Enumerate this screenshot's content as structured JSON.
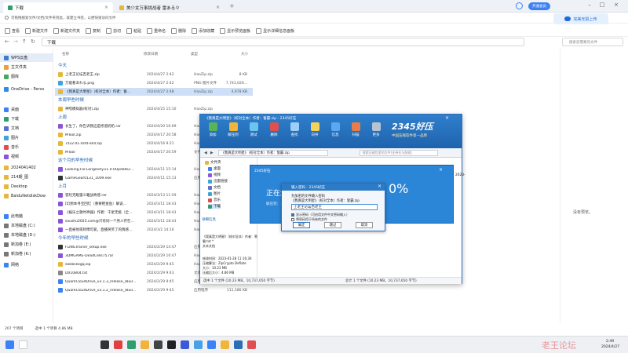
{
  "tabs": [
    {
      "label": "下载"
    },
    {
      "label": "美少女万事挑战者 雷ある々"
    }
  ],
  "vip": "开通会员",
  "notice": "可拖拽搜索文件/文档/文件夹到此，就建立书签，以便快速访问文件",
  "upload": "完美无损上传",
  "toolbar": [
    {
      "label": "查看",
      "icon": "eye-icon"
    },
    {
      "label": "新建文件",
      "icon": "new-file-icon"
    },
    {
      "label": "新建文件夹",
      "icon": "new-folder-icon"
    },
    {
      "label": "复制",
      "icon": "copy-icon"
    },
    {
      "label": "剪切",
      "icon": "cut-icon"
    },
    {
      "label": "粘贴",
      "icon": "paste-icon"
    },
    {
      "label": "重命名",
      "icon": "rename-icon"
    },
    {
      "label": "删除",
      "icon": "delete-icon"
    },
    {
      "label": "添加收藏",
      "icon": "star-icon"
    },
    {
      "label": "显示预览面板",
      "icon": "preview-icon"
    },
    {
      "label": "显示详细信息面板",
      "icon": "details-icon"
    }
  ],
  "address": "下载",
  "search_placeholder": "搜索您需要的文件",
  "sidebar": [
    {
      "label": "WPS云盘",
      "color": "#3a7bd5",
      "sel": true
    },
    {
      "label": "主文件夹",
      "color": "#e6a23c"
    },
    {
      "label": "图库",
      "color": "#48a860"
    },
    {
      "label": "OneDrive - Perso",
      "color": "#2d8ce6"
    },
    {
      "label": "桌面",
      "color": "#3b82f6"
    },
    {
      "label": "下载",
      "color": "#2f9e6a"
    },
    {
      "label": "文档",
      "color": "#5a6fd6"
    },
    {
      "label": "图片",
      "color": "#3aa5d6"
    },
    {
      "label": "音乐",
      "color": "#e24c4c"
    },
    {
      "label": "视频",
      "color": "#8a56d8"
    },
    {
      "label": "2024041402",
      "color": "#e6b73c"
    },
    {
      "label": "214期_图",
      "color": "#e6b73c"
    },
    {
      "label": "Desktop",
      "color": "#e6b73c"
    },
    {
      "label": "BaiduNetdiskDow",
      "color": "#e6b73c"
    },
    {
      "label": "此电脑",
      "color": "#3b82f6"
    },
    {
      "label": "本地磁盘 (C:)",
      "color": "#777"
    },
    {
      "label": "本地磁盘 (D:)",
      "color": "#777"
    },
    {
      "label": "新加卷 (E:)",
      "color": "#777"
    },
    {
      "label": "新加卷 (K:)",
      "color": "#777"
    },
    {
      "label": "网络",
      "color": "#3b82f6"
    }
  ],
  "columns": {
    "name": "名称",
    "date": "修改日期",
    "type": "类型",
    "size": "大小"
  },
  "groups": [
    {
      "label": "今天",
      "rows": [
        {
          "name": "上老王论坛百老王.zip",
          "date": "2024/4/27 2:42",
          "type": "HaoZip.zip",
          "size": "8 KB",
          "color": "#e6b73c"
        },
        {
          "name": "万能看あれる.png",
          "date": "2024/4/27 2:42",
          "type": "PNG 图片文件",
          "size": "7,741,020...",
          "color": "#3aa5d6"
        },
        {
          "name": "《我真是大明星》（校对全本）作者：誓...",
          "date": "2024/4/27 2:48",
          "type": "HaoZip.zip",
          "size": "4,978 KB",
          "color": "#e6b73c",
          "sel": true
        }
      ]
    },
    {
      "label": "本周早些时候",
      "rows": [
        {
          "name": "神嗒模拟器(校对).zip",
          "date": "2024/4/25 15:10",
          "type": "HaoZip.zip",
          "size": "",
          "color": "#e6b73c"
        }
      ]
    },
    {
      "label": "上周",
      "rows": [
        {
          "name": "长生了，你告诉我这是修道奶奶.rar",
          "date": "2024/4/20 16:09",
          "type": "HaoZip.rar",
          "size": "",
          "color": "#8a56d8"
        },
        {
          "name": "MTool.zip",
          "date": "2024/4/17 20:58",
          "type": "HaoZip.zip",
          "size": "",
          "color": "#e6b73c"
        },
        {
          "name": "7z22.01-zstd-x64.zip",
          "date": "2024/4/16 9:21",
          "type": "HaoZip.zip",
          "size": "",
          "color": "#e6b73c"
        },
        {
          "name": "MTool",
          "date": "2024/4/17 20:59",
          "type": "文件夹",
          "size": "",
          "color": "#e6b73c"
        }
      ]
    },
    {
      "label": "这个月的早些时候",
      "rows": [
        {
          "name": "Looking.For.Longevity.v1.0.0Update2...",
          "date": "2024/4/11 15:14",
          "type": "HaoZip.rar",
          "size": "",
          "color": "#8a56d8"
        },
        {
          "name": "GameGear0131_1009.exe",
          "date": "2024/4/11 15:13",
          "type": "应用程序",
          "size": "",
          "color": "#333"
        }
      ]
    },
    {
      "label": "上月",
      "rows": [
        {
          "name": "冒险无眠骚义籍战奇悠.rar",
          "date": "2024/3/13 11:59",
          "type": "HaoZip.rar",
          "size": "",
          "color": "#8a56d8"
        },
        {
          "name": "[幻想本寻宝回忆（重要鞋金鱼）解说...",
          "date": "2024/3/11 18:43",
          "type": "HaoZip.rar",
          "size": "",
          "color": "#8a56d8"
        },
        {
          "name": "《娱乐之歌时神器》作者：千星无极（全...",
          "date": "2024/3/11 18:43",
          "type": "HaoZip.rar",
          "size": "",
          "color": "#8a56d8"
        },
        {
          "name": "soushu2023.com@只有同一个男人存在...",
          "date": "2024/3/11 18:43",
          "type": "HaoZip.rar",
          "size": "",
          "color": "#8a56d8"
        },
        {
          "name": "一直被他或师傅可爱，直播哭笑了的情感...",
          "date": "2024/3/2 14:16",
          "type": "HaoZip.rar",
          "size": "",
          "color": "#8a56d8"
        }
      ]
    },
    {
      "label": "今年的早些时候",
      "rows": [
        {
          "name": "FLiNGTrainer_setup.exe",
          "date": "2024/2/29 14:47",
          "type": "应用程序",
          "size": "",
          "color": "#333"
        },
        {
          "name": "3DMGAME-DeadCells75.rar",
          "date": "2024/2/29 10:47",
          "type": "HaoZip.rar",
          "size": "",
          "color": "#8a56d8"
        },
        {
          "name": "swsbsexgq.zip",
          "date": "2024/2/29 9:45",
          "type": "HaoZip.zip",
          "size": "",
          "color": "#e6b73c"
        },
        {
          "name": "D010804.txt",
          "date": "2024/2/29 9:43",
          "type": "文本文档",
          "size": "",
          "color": "#888"
        },
        {
          "name": "QuarkCloudDrive_v3.1.3_release_(Buil...",
          "date": "2024/2/29 9:45",
          "type": "应用程序",
          "size": "111,186 KB",
          "color": "#3b82f6"
        },
        {
          "name": "QuarkCloudDrive_v3.1.2_release_(Buil...",
          "date": "2024/2/29 9:45",
          "type": "应用程序",
          "size": "111,186 KB",
          "color": "#3b82f6"
        }
      ]
    }
  ],
  "preview_text": "没有预览。",
  "status": {
    "count": "207 个项目",
    "selected": "选中 1 个项目  4.86 MB"
  },
  "zip": {
    "brand": "2345好压",
    "slogan": "中国压缩软件第一品牌",
    "title": "《我真是大明星》（校对全本）作者：誓霸.zip - 2345好压",
    "buttons": [
      "添加",
      "解压到",
      "测试",
      "删除",
      "查找",
      "向导",
      "信息",
      "扫描",
      "更多"
    ],
    "path": "《我真是大明星》（校对全本）作者：誓霸.zip",
    "search_placeholder": "搜索压缩包里的文件(支持名与前缀)",
    "tree": [
      "文件夹",
      "桌面",
      "视频",
      "迅雷链接",
      "文档",
      "图片",
      "音乐",
      "下载"
    ],
    "info_label": "详细信息",
    "info": [
      "《我真是大明星》（校对全本）作者：誓霸.txt *",
      "文本文档",
      "修改时间：2023-01-28 11:16:30",
      "压缩算法：ZipCrypto Deflate",
      "大小：10.23 MB",
      "压缩后大小：4.86 MB"
    ],
    "col": "安全",
    "year": "2023-",
    "status": "选中 1 个文件 (10.23 MB，10,737,650 字节)",
    "status2": "总计 1 个文件 (10.23 MB，10,737,650 字节)"
  },
  "progress": {
    "title": "2345好压",
    "text": "正在解",
    "sub": "解压到：..."
  },
  "pwd": {
    "title": "输入密码 - 2345好压",
    "prompt": "为加密的文件输入密码",
    "file": "《我真是大明星》（校对全本）作者：誓霸.zip",
    "value": "上老王论坛百老王",
    "show": "显示密码（可启用文件中文密码输入）",
    "save": "将密码用于所有的文件",
    "ok": "确定",
    "skip": "跳过",
    "cancel": "取消"
  },
  "clock": {
    "time": "2:49",
    "date": "2024/4/27"
  },
  "watermark": "老王论坛"
}
